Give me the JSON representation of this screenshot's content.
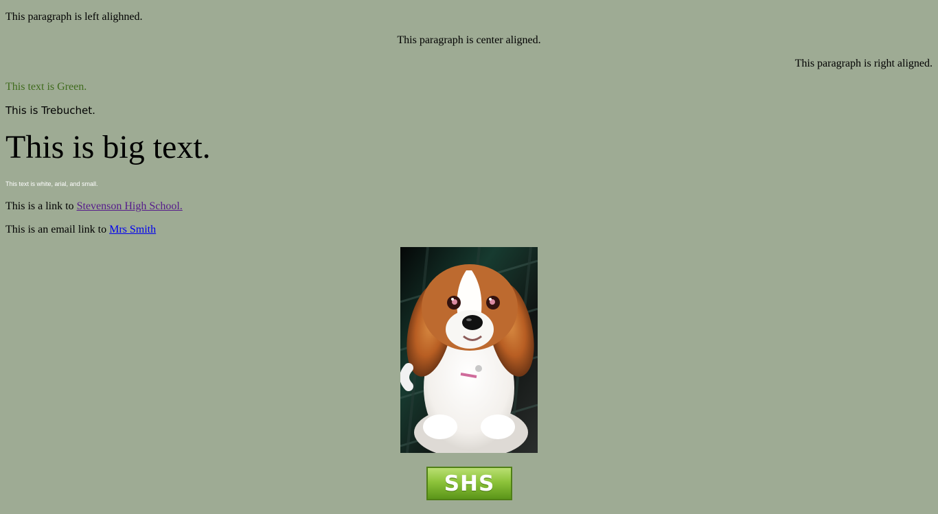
{
  "paragraphs": {
    "left": "This paragraph is left alighned.",
    "center": "This paragraph is center aligned.",
    "right": "This paragraph is right aligned.",
    "green": "This text is Green.",
    "trebuchet": "This is Trebuchet.",
    "big": "This is big text.",
    "small": "This text is white, arial, and small."
  },
  "links": {
    "school_prefix": "This is a link to ",
    "school_text": "Stevenson High School.",
    "email_prefix": "This is an email link to ",
    "email_text": "Mrs Smith"
  },
  "media": {
    "dog_icon": "dog-photo-icon",
    "button_label": "SHS"
  },
  "colors": {
    "background": "#9eab94",
    "green_text": "#3f6b1c",
    "visited_link": "#551a8b",
    "unvisited_link": "#0000ee",
    "button_green": "#8dc33a"
  }
}
